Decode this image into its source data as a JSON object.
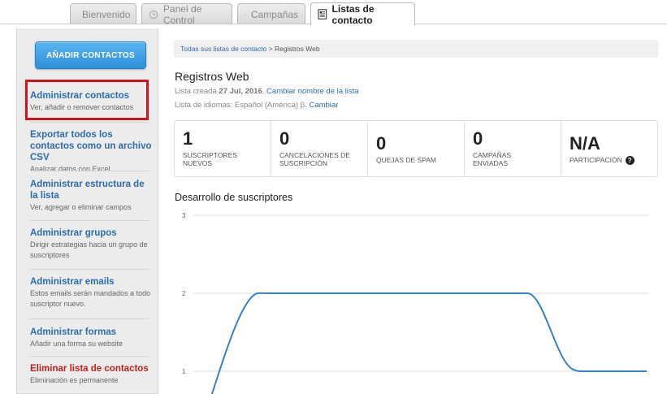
{
  "tabs": [
    {
      "label": "Bienvenido",
      "icon": "magic-wand-icon",
      "active": false
    },
    {
      "label": "Panel de Control",
      "icon": "clock-icon",
      "active": false
    },
    {
      "label": "Campañas",
      "icon": "envelope-icon",
      "active": false
    },
    {
      "label": "Listas de contacto",
      "icon": "contact-list-icon",
      "active": true
    }
  ],
  "sidebar": {
    "add_button": "AÑADIR CONTACTOS",
    "items": [
      {
        "title": "Administrar contactos",
        "desc": "Ver, añadir o remover contactos"
      },
      {
        "title": "Exportar todos los contactos como un archivo CSV",
        "desc": "Analizar datos con Excel"
      },
      {
        "title": "Administrar estructura de la lista",
        "desc": "Ver, agregar o eliminar campos"
      },
      {
        "title": "Administrar grupos",
        "desc": "Dirigir estrategias hacia un grupo de suscriptores"
      },
      {
        "title": "Administrar emails",
        "desc": "Estos emails serán mandados a todo suscriptor nuevo."
      },
      {
        "title": "Administrar formas",
        "desc": "Añadir una forma su website"
      },
      {
        "title": "Eliminar lista de contactos",
        "desc": "Eliminación es permanente"
      }
    ]
  },
  "breadcrumb": {
    "link": "Todas sus listas de contacto",
    "separator": " > ",
    "current": "Registros Web"
  },
  "list": {
    "title": "Registros Web",
    "created_prefix": "Lista creada ",
    "created_date": "27 Jul, 2016",
    "created_suffix": ". ",
    "rename_link": "Cambiar nombre de la lista",
    "language_text": "Lista de idiomas: Español (América) β. ",
    "language_link": "Cambiar"
  },
  "stats": [
    {
      "value": "1",
      "label_line1": "SUSCRIPTORES",
      "label_line2": "NUEVOS"
    },
    {
      "value": "0",
      "label_line1": "CANCELACIONES DE",
      "label_line2": "SUSCRIPCIÓN"
    },
    {
      "value": "0",
      "label_line1": "QUEJAS DE SPAM",
      "label_line2": ""
    },
    {
      "value": "0",
      "label_line1": "CAMPAÑAS",
      "label_line2": "ENVIADAS"
    },
    {
      "value": "N/A",
      "label_line1": "PARTICIPACIÓN",
      "label_line2": ""
    }
  ],
  "chart_title": "Desarrollo de suscriptores",
  "chart_data": {
    "type": "line",
    "title": "Desarrollo de suscriptores",
    "y_ticks": [
      "3",
      "2",
      "1"
    ],
    "ylim": [
      1,
      3
    ],
    "line_color": "#3a80c8",
    "grid": true,
    "values": [
      0.0,
      2,
      2,
      2,
      1,
      1
    ]
  }
}
